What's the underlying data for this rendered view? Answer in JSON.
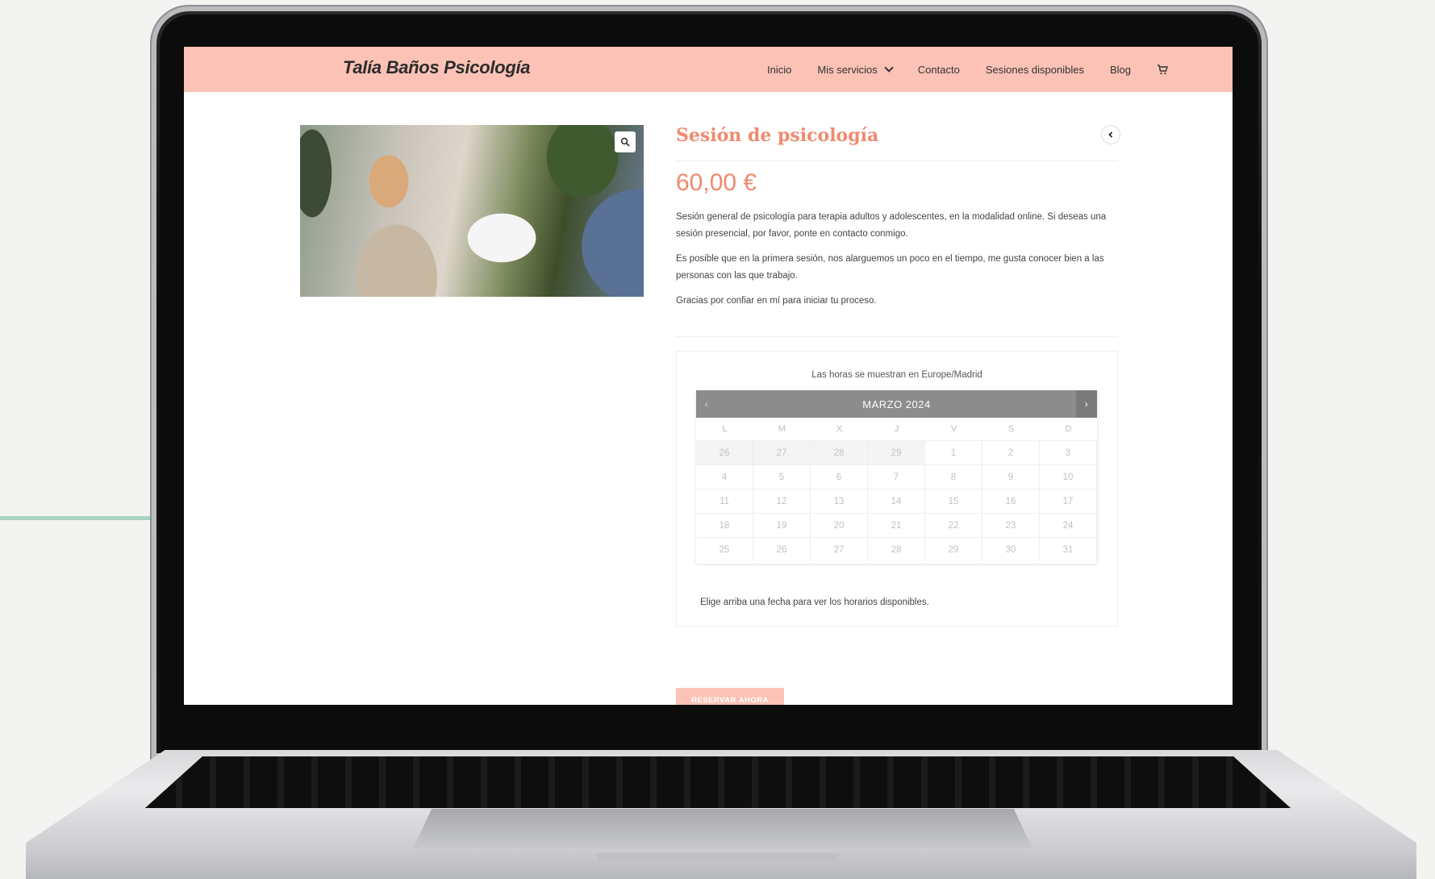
{
  "site": {
    "brand": "Talía Baños Psicología",
    "nav": [
      {
        "label": "Inicio"
      },
      {
        "label": "Mis servicios"
      },
      {
        "label": "Contacto"
      },
      {
        "label": "Sesiones disponibles"
      },
      {
        "label": "Blog"
      }
    ],
    "cart_icon": "cart-icon",
    "accent_color": "#fbc2b5",
    "title_color": "#ef8a6f"
  },
  "product": {
    "zoom_icon": "search-icon",
    "title": "Sesión de psicología",
    "price": "60,00 €",
    "paragraphs": [
      "Sesión general de psicología para terapia adultos y adolescentes, en la modalidad online. Si deseas una sesión presencial, por favor, ponte en contacto conmigo.",
      "Es posible que en la primera sesión, nos alarguemos un poco en el tiempo, me gusta conocer bien a las personas con las que trabajo.",
      "Gracias por confiar en mí para iniciar tu proceso."
    ]
  },
  "booking": {
    "timezone_note": "Las horas se muestran en Europe/Madrid",
    "month": "MARZO 2024",
    "prev": "‹",
    "next": "›",
    "weekdays": [
      "L",
      "M",
      "X",
      "J",
      "V",
      "S",
      "D"
    ],
    "weeks": [
      [
        "26",
        "27",
        "28",
        "29",
        "1",
        "2",
        "3"
      ],
      [
        "4",
        "5",
        "6",
        "7",
        "8",
        "9",
        "10"
      ],
      [
        "11",
        "12",
        "13",
        "14",
        "15",
        "16",
        "17"
      ],
      [
        "18",
        "19",
        "20",
        "21",
        "22",
        "23",
        "24"
      ],
      [
        "25",
        "26",
        "27",
        "28",
        "29",
        "30",
        "31"
      ]
    ],
    "choose_note": "Elige arriba una fecha para ver los horarios disponibles.",
    "reserve_label": "RESERVAR AHORA"
  }
}
